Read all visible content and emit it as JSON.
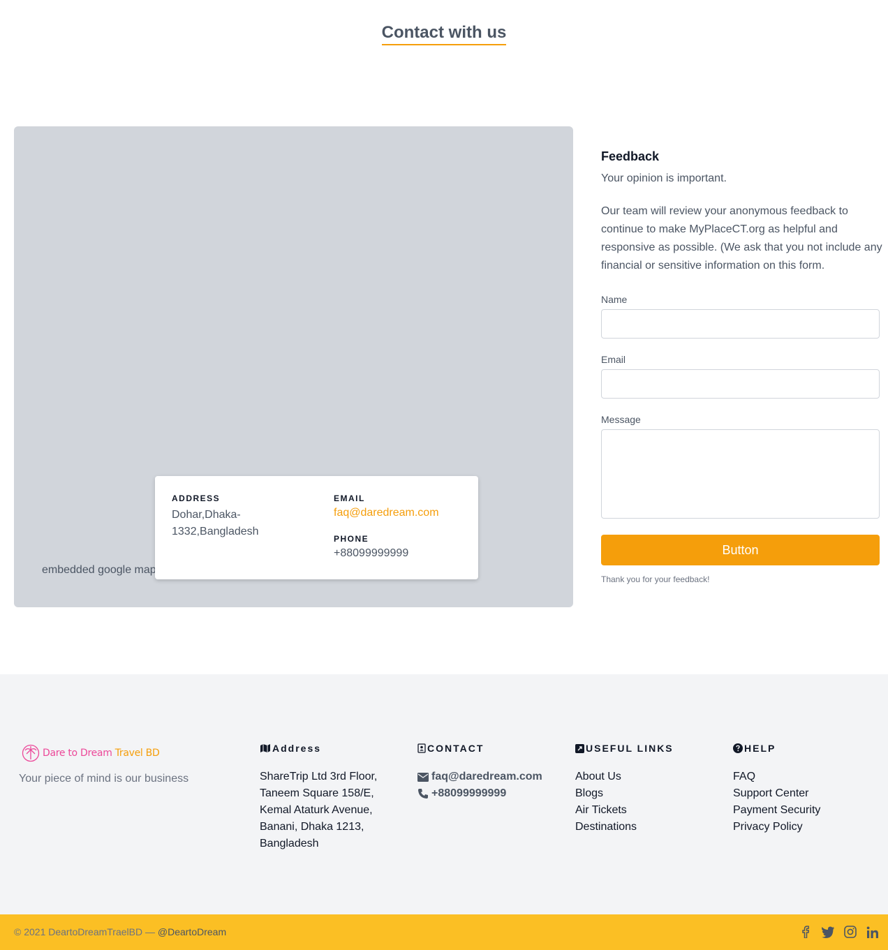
{
  "header": {
    "title": "Contact with us"
  },
  "map": {
    "placeholder_text": "embedded google map",
    "address_label": "ADDRESS",
    "address_value": "Dohar,Dhaka-1332,Bangladesh",
    "email_label": "EMAIL",
    "email_value": "faq@daredream.com",
    "phone_label": "PHONE",
    "phone_value": "+88099999999"
  },
  "feedback": {
    "title": "Feedback",
    "subtitle": "Your opinion is important.",
    "body": "Our team will review your anonymous feedback to continue to make MyPlaceCT.org as helpful and responsive as possible. (We ask that you not include any financial or sensitive information on this form.",
    "name_label": "Name",
    "name_value": "",
    "email_label": "Email",
    "email_value": "",
    "message_label": "Message",
    "message_value": "",
    "button_label": "Button",
    "thanks": "Thank you for your feedback!"
  },
  "footer": {
    "logo_text_1": "Dare to Dream",
    "logo_text_2": "Travel BD",
    "tagline": "Your piece of mind is our business",
    "address": {
      "heading": "Address",
      "text": "ShareTrip Ltd 3rd Floor, Taneem Square 158/E, Kemal Ataturk Avenue, Banani, Dhaka 1213, Bangladesh"
    },
    "contact": {
      "heading": "CONTACT",
      "email": "faq@daredream.com",
      "phone": "+88099999999"
    },
    "useful_links": {
      "heading": "USEFUL LINKS",
      "items": [
        "About Us",
        "Blogs",
        "Air Tickets",
        "Destinations"
      ]
    },
    "help": {
      "heading": "HELP",
      "items": [
        "FAQ",
        "Support Center",
        "Payment Security",
        "Privacy Policy"
      ]
    }
  },
  "bottom_bar": {
    "copyright": "© 2021 DeartoDreamTraelBD —",
    "handle": "@DeartoDream",
    "social_icons": [
      "facebook-icon",
      "twitter-icon",
      "instagram-icon",
      "linkedin-icon"
    ]
  },
  "colors": {
    "accent": "#f59e0b",
    "bottom_bar": "#fbbf24",
    "map_bg": "#d1d5db",
    "footer_bg": "#f3f4f6"
  }
}
